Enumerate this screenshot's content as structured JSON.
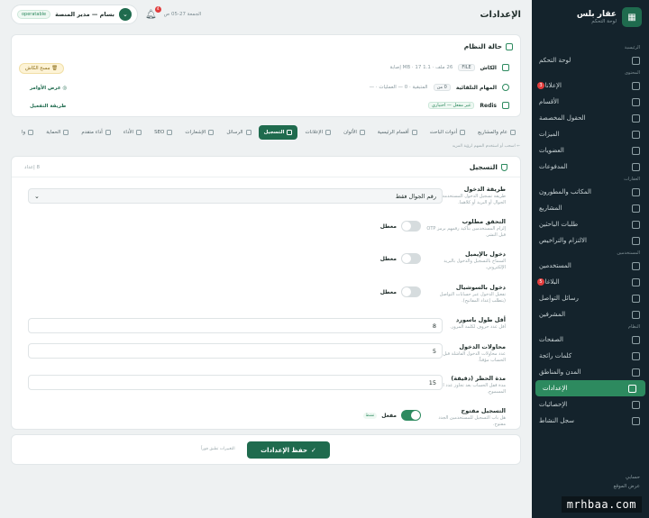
{
  "sidebar": {
    "brand_name": "عقار بلس",
    "brand_sub": "لوحة التحكم",
    "sections": [
      {
        "title": "الرئيسية",
        "items": [
          {
            "label": "لوحة التحكم",
            "icon": "dashboard-icon"
          }
        ]
      },
      {
        "title": "المحتوى",
        "items": [
          {
            "label": "الإعلانات",
            "icon": "home-icon",
            "badge": "3"
          },
          {
            "label": "الأقسام",
            "icon": "folder-icon"
          },
          {
            "label": "الحقول المخصصة",
            "icon": "fields-icon"
          },
          {
            "label": "الميزات",
            "icon": "star-icon"
          },
          {
            "label": "العضويات",
            "icon": "crown-icon"
          },
          {
            "label": "المدفوعات",
            "icon": "card-icon"
          }
        ]
      },
      {
        "title": "العقارات",
        "items": [
          {
            "label": "المكاتب والمطورون",
            "icon": "building-icon"
          },
          {
            "label": "المشاريع",
            "icon": "project-icon"
          },
          {
            "label": "طلبات الباحثين",
            "icon": "search-icon"
          },
          {
            "label": "الالتزام والتراخيص",
            "icon": "license-icon"
          }
        ]
      },
      {
        "title": "المستخدمين",
        "items": [
          {
            "label": "المستخدمين",
            "icon": "users-icon"
          },
          {
            "label": "البلاغات",
            "icon": "flag-icon",
            "badge": "5"
          },
          {
            "label": "رسائل التواصل",
            "icon": "mail-icon"
          },
          {
            "label": "المشرفين",
            "icon": "admin-icon"
          }
        ]
      },
      {
        "title": "النظام",
        "items": [
          {
            "label": "الصفحات",
            "icon": "page-icon"
          },
          {
            "label": "كلمات رائجة",
            "icon": "tag-icon"
          },
          {
            "label": "المدن والمناطق",
            "icon": "globe-icon"
          },
          {
            "label": "الإعدادات",
            "icon": "gear-icon",
            "active": true
          },
          {
            "label": "الإحصائيات",
            "icon": "chart-icon"
          },
          {
            "label": "سجل النشاط",
            "icon": "history-icon"
          }
        ]
      }
    ],
    "footer": [
      "حسابي",
      "عرض الموقع"
    ]
  },
  "watermark": "mrhbaa.com",
  "topbar": {
    "title": "الإعدادات",
    "date": "الجمعة 27-05 ص",
    "notif_count": "4",
    "user_label": "بسام — مدير المنصة",
    "status": "operatable"
  },
  "system": {
    "title": "حالة النظام",
    "rows": [
      {
        "name": "الكاش",
        "tag": "FILE",
        "info": "26 ملف · 1.1 MB · 17 إصابة"
      },
      {
        "name": "المهام التلقائية",
        "tag": "0 من",
        "info": "المتبقية · 0 — العمليات · —"
      },
      {
        "name": "Redis",
        "tag": "غير مفعل — اختياري",
        "info": ""
      }
    ],
    "clear_button": "مسح الكاش",
    "cron_link": "عرض الأوامر",
    "enable_link": "طريقة التفعيل"
  },
  "tabs": [
    {
      "label": "عام والمشاريع",
      "icon": "building-icon"
    },
    {
      "label": "أدوات الباحث",
      "icon": "search-icon"
    },
    {
      "label": "أقسام الرئيسية",
      "icon": "grid-icon"
    },
    {
      "label": "الألوان",
      "icon": "palette-icon"
    },
    {
      "label": "الإعلانات",
      "icon": "home-icon"
    },
    {
      "label": "التسجيل",
      "icon": "shield-icon",
      "active": true
    },
    {
      "label": "الرسائل",
      "icon": "mail-icon"
    },
    {
      "label": "الإشعارات",
      "icon": "bell-icon"
    },
    {
      "label": "SEO",
      "icon": "search-icon"
    },
    {
      "label": "الأداء",
      "icon": "speed-icon"
    },
    {
      "label": "أداء متقدم",
      "icon": "bolt-icon"
    },
    {
      "label": "الحماية",
      "icon": "lock-icon"
    },
    {
      "label": "وا",
      "icon": "gear-icon"
    }
  ],
  "tabs_hint": "← اسحب أو استخدم السهم لرؤية المزيد",
  "registration": {
    "title": "التسجيل",
    "count": "8 إعداد",
    "method": {
      "label": "طريقة الدخول",
      "desc": "طريقة تسجيل الدخول المستخدمة. رقم الجوال أو البريد أو كلاهما.",
      "value": "رقم الجوال فقط"
    },
    "verify": {
      "label": "التحقق مطلوب",
      "desc": "إلزام المستخدمين بتأكيد رقمهم برمز OTP قبل النشر.",
      "state": "معطل"
    },
    "email_login": {
      "label": "دخول بالإيميل",
      "desc": "السماح بالتسجيل والدخول بالبريد الإلكتروني.",
      "state": "معطل"
    },
    "social_login": {
      "label": "دخول بالسوشيال",
      "desc": "تفعيل الدخول عبر حسابات التواصل (يتطلب إعداد المفاتيح).",
      "state": "معطل"
    },
    "min_password": {
      "label": "أقل طول باسورد",
      "desc": "أقل عدد حروف لكلمة المرور.",
      "value": "8"
    },
    "login_attempts": {
      "label": "محاولات الدخول",
      "desc": "عدد محاولات الدخول الفاشلة قبل قفل الحساب مؤقتاً.",
      "value": "5"
    },
    "lockout": {
      "label": "مدة الحظر (دقيقة)",
      "desc": "مدة قفل الحساب بعد تجاوز عدد المحاولات المسموح.",
      "value": "15"
    },
    "open_registration": {
      "label": "التسجيل مفتوح",
      "desc": "هل باب التسجيل للمستخدمين الجدد مفتوح.",
      "state": "مفعل",
      "tag": "نشط"
    }
  },
  "save": {
    "button": "حفظ الإعدادات",
    "hint": "التغييرات تطبق فوراً"
  }
}
